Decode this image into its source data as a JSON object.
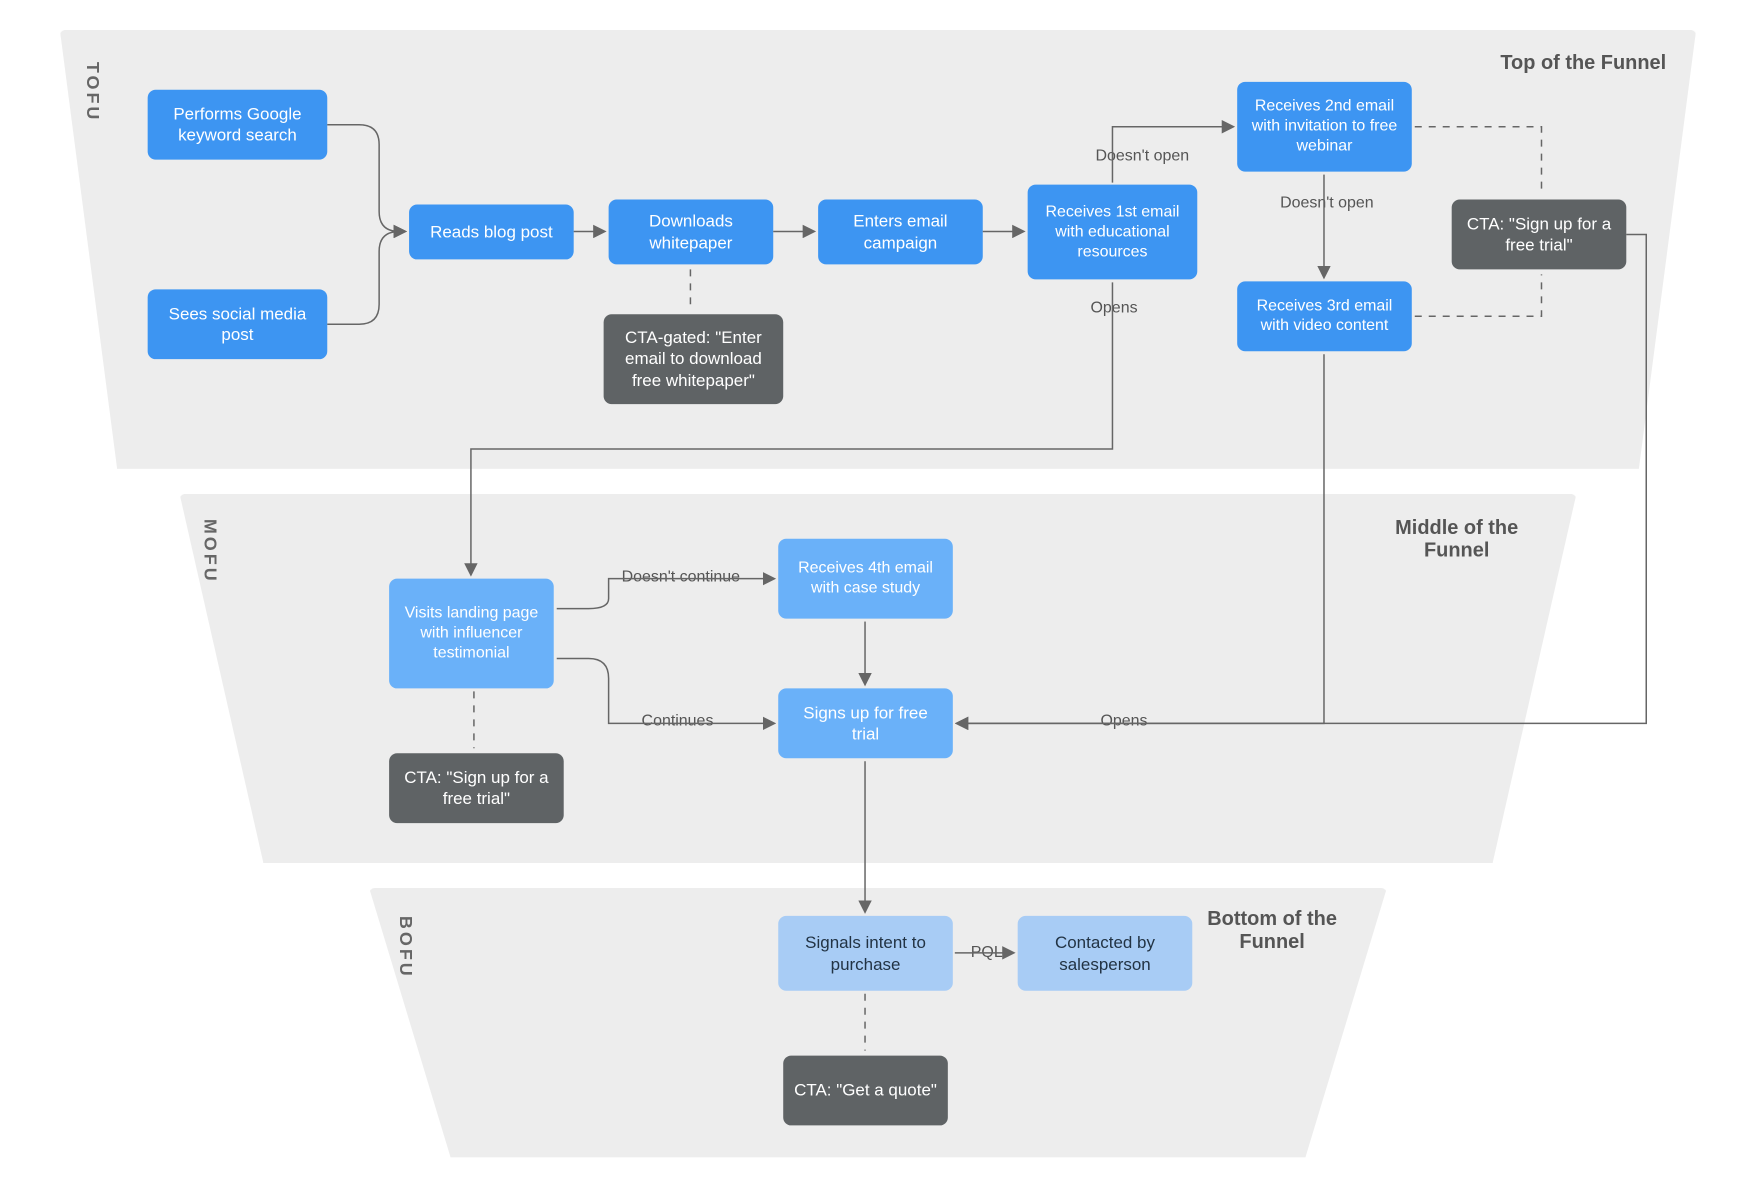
{
  "zones": {
    "tofu": {
      "tag": "TOFU",
      "title": "Top of the Funnel"
    },
    "mofu": {
      "tag": "MOFU",
      "title": "Middle of the Funnel"
    },
    "bofu": {
      "tag": "BOFU",
      "title": "Bottom of the Funnel"
    }
  },
  "nodes": {
    "googleSearch": "Performs Google keyword search",
    "socialPost": "Sees social media post",
    "readsBlog": "Reads blog post",
    "downloadsWp": "Downloads whitepaper",
    "ctaWp": "CTA-gated: \"Enter email to download free whitepaper\"",
    "entersCampaign": "Enters email campaign",
    "email1": "Receives 1st email with educational resources",
    "email2": "Receives 2nd email with invitation to free webinar",
    "email3": "Receives 3rd email with video content",
    "ctaTrialTop": "CTA: \"Sign up for a free trial\"",
    "landing": "Visits landing page with influencer testimonial",
    "ctaTrialMid": "CTA: \"Sign up for a free trial\"",
    "email4": "Receives 4th email with case study",
    "signup": "Signs up for free trial",
    "intent": "Signals intent to purchase",
    "ctaQuote": "CTA: \"Get a quote\"",
    "contacted": "Contacted by salesperson"
  },
  "edgeLabels": {
    "doesntOpen1": "Doesn't open",
    "opens1": "Opens",
    "doesntOpen2": "Doesn't open",
    "doesntContinue": "Doesn't continue",
    "continues": "Continues",
    "opens2": "Opens",
    "pql": "PQL"
  }
}
